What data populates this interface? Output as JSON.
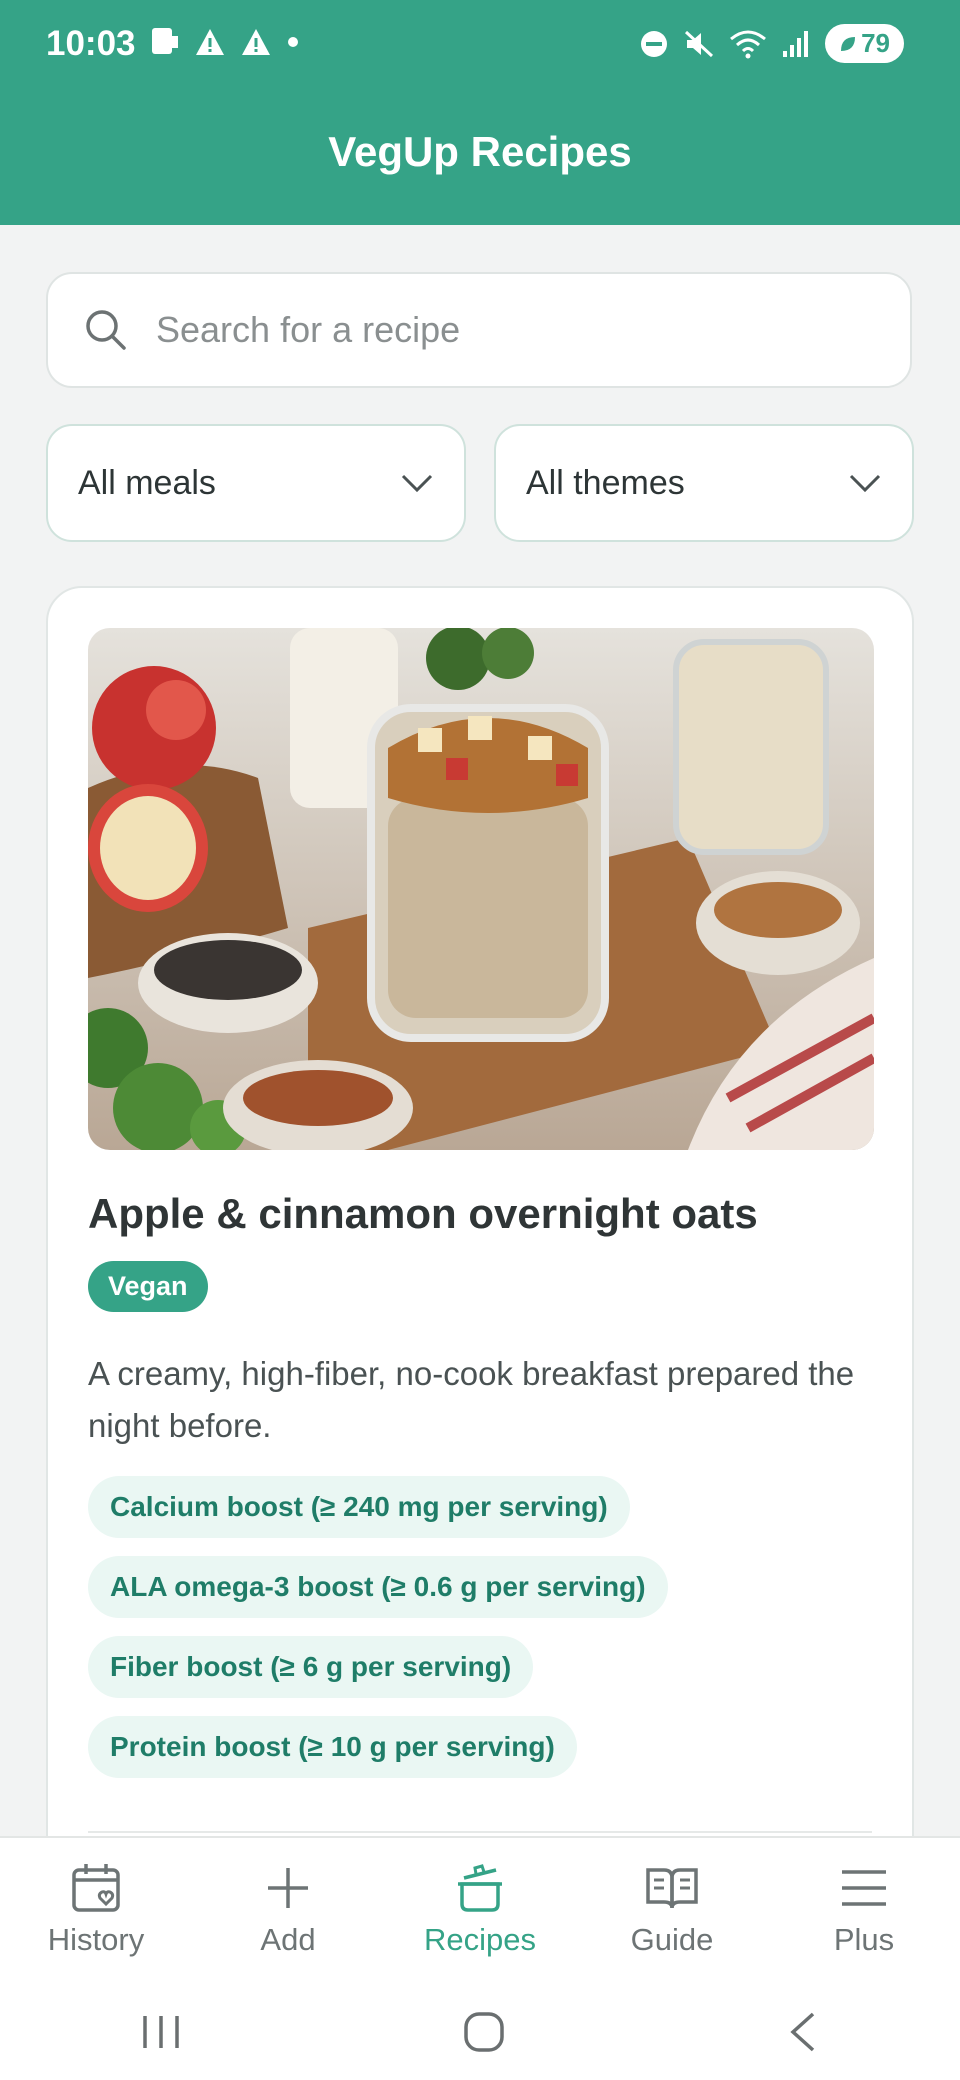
{
  "status_bar": {
    "time": "10:03",
    "battery": "79"
  },
  "app_bar": {
    "title": "VegUp Recipes"
  },
  "search": {
    "placeholder": "Search for a recipe"
  },
  "filters": {
    "meal": "All meals",
    "theme": "All themes"
  },
  "recipe": {
    "title": "Apple & cinnamon overnight oats",
    "badge": "Vegan",
    "description": "A creamy, high-fiber, no-cook breakfast prepared the night before.",
    "tags": [
      "Calcium boost (≥ 240 mg per serving)",
      "ALA omega-3 boost (≥ 0.6 g per serving)",
      "Fiber boost (≥ 6 g per serving)",
      "Protein boost (≥ 10 g per serving)"
    ]
  },
  "bottom_nav": {
    "items": [
      {
        "label": "History",
        "icon": "calendar-heart-icon"
      },
      {
        "label": "Add",
        "icon": "plus-icon"
      },
      {
        "label": "Recipes",
        "icon": "cooking-pot-icon"
      },
      {
        "label": "Guide",
        "icon": "open-book-icon"
      },
      {
        "label": "Plus",
        "icon": "menu-icon"
      }
    ],
    "active": "Recipes"
  },
  "colors": {
    "brand": "#35a387",
    "tag_bg": "#eaf7f3",
    "tag_text": "#1f7d68"
  }
}
